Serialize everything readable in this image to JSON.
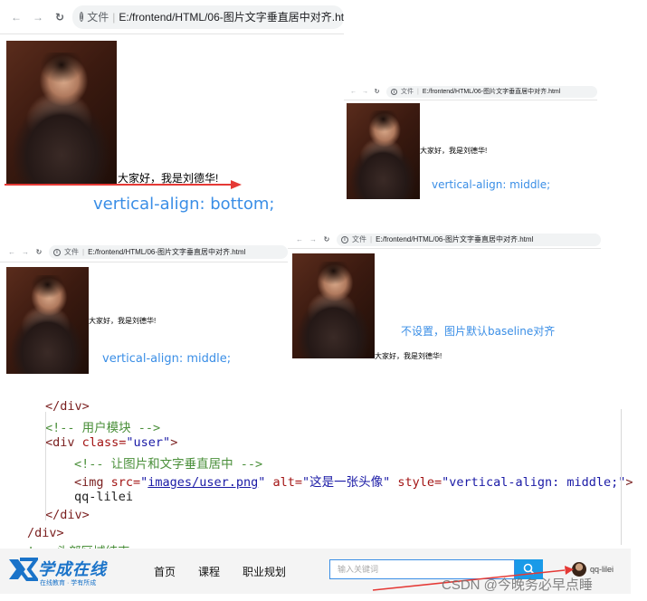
{
  "browser": {
    "file_label": "文件",
    "url": "E:/frontend/HTML/06-图片文字垂直居中对齐.html"
  },
  "panels": {
    "p1": {
      "caption": "大家好，我是刘德华!",
      "note": "vertical-align: bottom;"
    },
    "p2": {
      "caption": "大家好，我是刘德华!",
      "note": "vertical-align: middle;"
    },
    "p3": {
      "caption": "大家好，我是刘德华!",
      "note": "vertical-align: middle;"
    },
    "p4": {
      "caption": "大家好，我是刘德华!",
      "note": "不设置，图片默认baseline对齐"
    }
  },
  "code": {
    "l0": "</div>",
    "l1": "<!-- 用户模块 -->",
    "l2_tag": "<div ",
    "l2_attr": "class=",
    "l2_val": "\"user\"",
    "l2_end": ">",
    "l3": "<!-- 让图片和文字垂直居中 -->",
    "l4_tag": "<img ",
    "l4_src": "src=",
    "l4_q1": "\"",
    "l4_path": "images/user.png",
    "l4_q2": "\"",
    "l4_alt": " alt=",
    "l4_altv": "\"这是一张头像\"",
    "l4_style": " style=",
    "l4_stylev": "\"vertical-align: middle;\"",
    "l4_end": ">",
    "l5": "qq-lilei",
    "l6": "</div>",
    "l7": "/div>",
    "l8": "!-- 头部区域结束 -->"
  },
  "site": {
    "logo_main": "学成在线",
    "logo_sub": "在线教育 · 学有所成",
    "nav": [
      "首页",
      "课程",
      "职业规划"
    ],
    "search_placeholder": "输入关键词",
    "username": "qq-lilei"
  },
  "watermark": "CSDN @今晚务必早点睡",
  "colors": {
    "accent": "#3a8ee6",
    "arrow": "#e53935",
    "search_btn": "#1a9ae8"
  },
  "icons": [
    "back-arrow-icon",
    "forward-arrow-icon",
    "reload-icon",
    "info-icon",
    "search-icon",
    "avatar"
  ]
}
